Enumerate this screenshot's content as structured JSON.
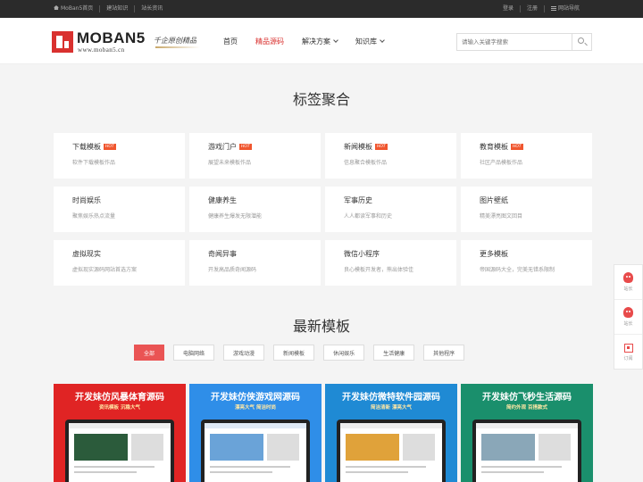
{
  "topbar": {
    "links_left": [
      "MoBan5首页",
      "建站知识",
      "站长资讯"
    ],
    "links_right": [
      "登录",
      "注册",
      "网站导航"
    ]
  },
  "header": {
    "logo_text": "MOBAN5",
    "logo_url": "www.moban5.cn",
    "slogan": "千企原创精品",
    "nav": [
      {
        "label": "首页",
        "active": false,
        "dropdown": false
      },
      {
        "label": "精品源码",
        "active": true,
        "dropdown": false
      },
      {
        "label": "解决方案",
        "active": false,
        "dropdown": true
      },
      {
        "label": "知识库",
        "active": false,
        "dropdown": true
      }
    ],
    "search_placeholder": "请输入关键字搜索"
  },
  "tags_section": {
    "title": "标签聚合",
    "tags": [
      {
        "name": "下载模板",
        "hot": "HOT",
        "desc": "软件下载模板作品"
      },
      {
        "name": "游戏门户",
        "hot": "HOT",
        "desc": "展望未来模板作品"
      },
      {
        "name": "新闻模板",
        "hot": "HOT",
        "desc": "信息聚合模板作品"
      },
      {
        "name": "教育模板",
        "hot": "HOT",
        "desc": "社区产品模板作品"
      },
      {
        "name": "时尚娱乐",
        "hot": "",
        "desc": "聚焦娱乐热点流量"
      },
      {
        "name": "健康养生",
        "hot": "",
        "desc": "健康养生爆发无限潜能"
      },
      {
        "name": "军事历史",
        "hot": "",
        "desc": "人人都读军事和历史"
      },
      {
        "name": "图片壁纸",
        "hot": "",
        "desc": "精美漂亮图文回目"
      },
      {
        "name": "虚拟现实",
        "hot": "",
        "desc": "虚拟现实源码网站首选方案"
      },
      {
        "name": "奇闻异事",
        "hot": "",
        "desc": "开发高品质奇闻源码"
      },
      {
        "name": "微信小程序",
        "hot": "",
        "desc": "良心模板开发者，熊出体验佳"
      },
      {
        "name": "更多模板",
        "hot": "",
        "desc": "帝国源码大全，完美无错系限制"
      }
    ]
  },
  "latest_section": {
    "title": "最新模板",
    "tabs": [
      "全部",
      "电脑网络",
      "游戏动漫",
      "新闻模板",
      "休闲娱乐",
      "生活健康",
      "其他程序"
    ],
    "active_tab": 0,
    "cards": [
      {
        "title": "开发妹仿风暴体育源码",
        "subtitle": "资讯模板 沉稳大气"
      },
      {
        "title": "开发妹仿侠游戏网源码",
        "subtitle": "漂亮大气 简洁时尚"
      },
      {
        "title": "开发妹仿微特软件园源码",
        "subtitle": "简洁清新 漂亮大气"
      },
      {
        "title": "开发妹仿飞秒生活源码",
        "subtitle": "简约外观 百搭款式"
      }
    ]
  },
  "sidebar": {
    "items": [
      "站长",
      "站长",
      "订阅"
    ]
  },
  "colors": {
    "accent": "#d9312f",
    "hot_badge": "#f0562f",
    "tab_active": "#ea5454",
    "topbar_bg": "#2b2b2b"
  }
}
